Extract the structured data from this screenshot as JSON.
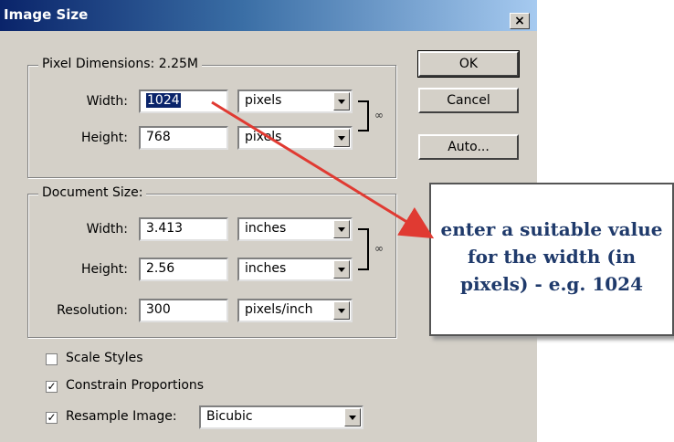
{
  "window": {
    "title": "Image Size",
    "close": "×"
  },
  "pixel_dimensions": {
    "legend": "Pixel Dimensions:  2.25M",
    "width_label": "Width:",
    "width_value": "1024",
    "width_unit": "pixels",
    "height_label": "Height:",
    "height_value": "768",
    "height_unit": "pixels"
  },
  "document_size": {
    "legend": "Document Size:",
    "width_label": "Width:",
    "width_value": "3.413",
    "width_unit": "inches",
    "height_label": "Height:",
    "height_value": "2.56",
    "height_unit": "inches",
    "resolution_label": "Resolution:",
    "resolution_value": "300",
    "resolution_unit": "pixels/inch"
  },
  "options": {
    "scale_styles": {
      "label": "Scale Styles",
      "checked": false
    },
    "constrain_proportions": {
      "label": "Constrain Proportions",
      "checked": true
    },
    "resample_image": {
      "label": "Resample Image:",
      "checked": true,
      "method": "Bicubic"
    }
  },
  "buttons": {
    "ok": "OK",
    "cancel": "Cancel",
    "auto": "Auto..."
  },
  "annotation": {
    "lines": [
      "enter a suitable value",
      "for the width (in",
      "pixels) - e.g. 1024"
    ],
    "arrow_color": "#e03a32"
  }
}
